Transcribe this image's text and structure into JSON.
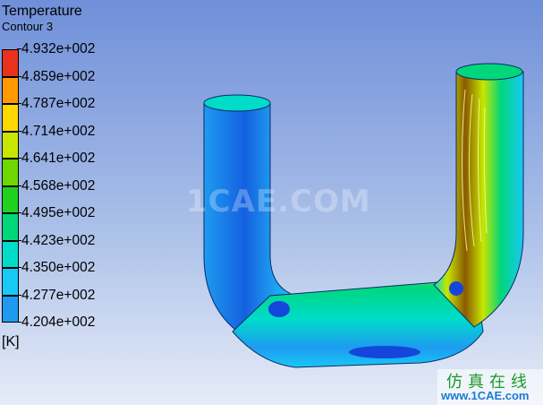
{
  "title": "Temperature",
  "subtitle": "Contour 3",
  "unit": "[K]",
  "legend": {
    "ticks": [
      "4.932e+002",
      "4.859e+002",
      "4.787e+002",
      "4.714e+002",
      "4.641e+002",
      "4.568e+002",
      "4.495e+002",
      "4.423e+002",
      "4.350e+002",
      "4.277e+002",
      "4.204e+002"
    ],
    "colors": [
      "#e8321c",
      "#ff9a00",
      "#ffd800",
      "#c8e600",
      "#6ed800",
      "#1ed21e",
      "#00d77a",
      "#00dcc8",
      "#18c8f5",
      "#1e9bf0",
      "#1446dc"
    ]
  },
  "watermark": "1CAE.COM",
  "site": {
    "cn": "仿真在线",
    "url": "www.1CAE.com"
  }
}
